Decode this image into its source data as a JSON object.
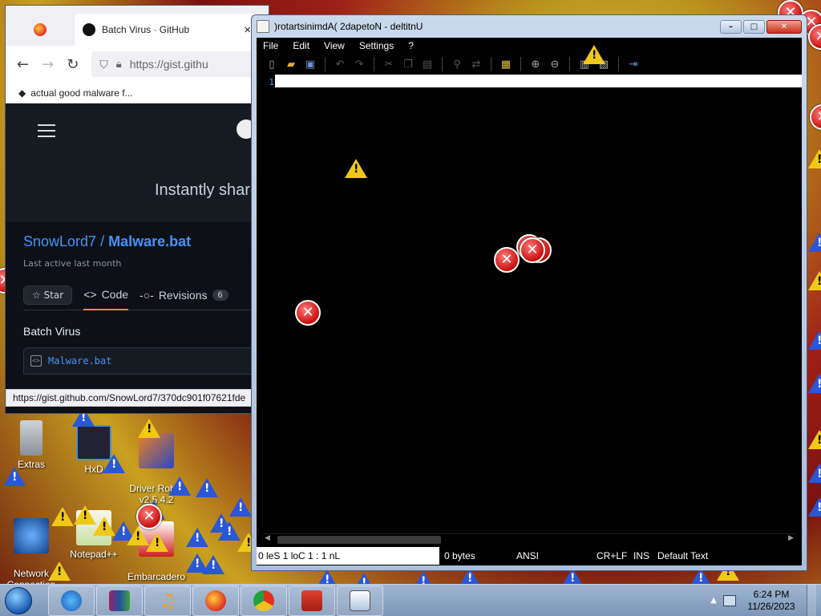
{
  "desktop": {
    "icons": [
      {
        "label": "Extras"
      },
      {
        "label": "HxD"
      },
      {
        "label": "Driver Robot\nv2.5.4.2"
      },
      {
        "label": "Network\nConnection"
      },
      {
        "label": "Notepad++"
      },
      {
        "label": "Embarcadero\nDev-C++"
      }
    ]
  },
  "browser": {
    "tabs": [
      {
        "label": ""
      },
      {
        "label": "Batch Virus · GitHub"
      }
    ],
    "tab_close": "×",
    "url": "https://gist.githu",
    "bookmark": "actual good malware f...",
    "banner_text": "Instantly share",
    "gist": {
      "owner": "SnowLord7",
      "separator": "/",
      "name": "Malware.bat",
      "last_active": "Last active last month",
      "star_label": "Star",
      "code_tab": "Code",
      "revisions_tab": "Revisions",
      "revisions_count": "6",
      "description": "Batch Virus",
      "file_name": "Malware.bat"
    },
    "status_url": "https://gist.github.com/SnowLord7/370dc901f07621fde"
  },
  "notepad": {
    "title": ")rotartsinimdA( 2dapetoN - deltitnU",
    "menu": [
      "File",
      "Edit",
      "View",
      "Settings",
      "?"
    ],
    "line_number": "1",
    "status": {
      "position": "0 leS  1 loC  1 : 1 nL",
      "size": "0 bytes",
      "encoding": "ANSI",
      "line_endings": "CR+LF",
      "mode": "INS",
      "scheme": "Default Text"
    },
    "window_buttons": {
      "minimize": "–",
      "maximize": "□",
      "close": "✕"
    }
  },
  "taskbar": {
    "clock_time": "6:24 PM",
    "clock_date": "11/26/2023",
    "apps": [
      "internet-explorer",
      "winrar",
      "media-player",
      "firefox",
      "chrome",
      "toolbox",
      "notepad2"
    ]
  },
  "colors": {
    "editor_bg": "#000000",
    "gh_link": "#4493f8",
    "warning": "#f0c818",
    "error": "#c81010"
  }
}
